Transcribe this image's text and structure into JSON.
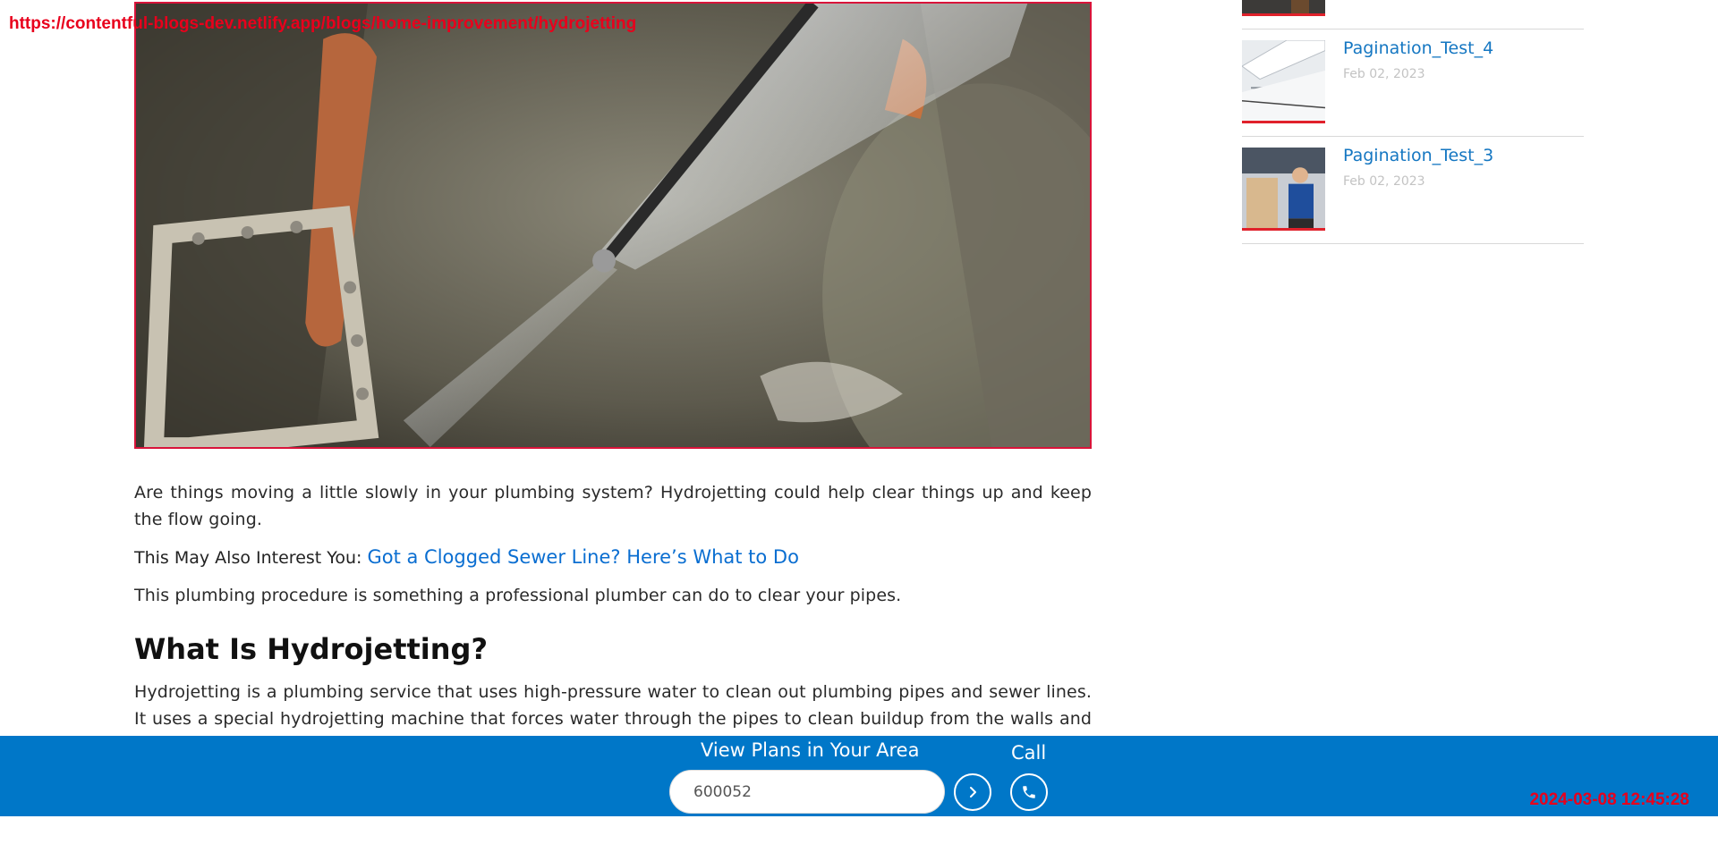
{
  "overlay": {
    "url": "https://contentful-blogs-dev.netlify.app/blogs/home-improvement/hydrojetting",
    "timestamp": "2024-03-08 12:45:28"
  },
  "article": {
    "paragraph_1": "Are things moving a little slowly in your plumbing system? Hydrojetting could help clear things up and keep the flow going.",
    "interest_label": "This May Also Interest You:",
    "interest_link": "Got a Clogged Sewer Line? Here’s What to Do",
    "paragraph_2": "This plumbing procedure is something a professional plumber can do to clear your pipes.",
    "heading": "What Is Hydrojetting?",
    "paragraph_3": "Hydrojetting is a plumbing service that uses high-pressure water to clean out plumbing pipes and sewer lines. It uses a special hydrojetting machine that forces water through the pipes to clean buildup from the walls and clogs from the"
  },
  "sidebar": {
    "items": [
      {
        "title": "Pagination_Test_4",
        "date": "Feb 02, 2023"
      },
      {
        "title": "Pagination_Test_3",
        "date": "Feb 02, 2023"
      }
    ]
  },
  "bottom_bar": {
    "heading": "View Plans in Your Area",
    "zip_value": "600052",
    "call_label": "Call",
    "go_icon": "chevron-right-icon",
    "call_icon": "phone-icon"
  },
  "colors": {
    "brand_blue": "#0077c8",
    "link_blue": "#0a6ed1",
    "accent_red": "#e0212b"
  }
}
